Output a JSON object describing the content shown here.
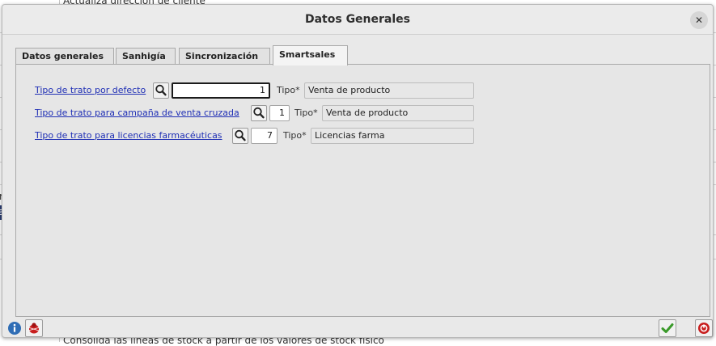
{
  "background": {
    "top_text": "Actualiza dirección de cliente",
    "left_fragments": [
      "r",
      "a"
    ],
    "bottom_text": "Consolida las líneas de stock a partir de los valores de stock físico"
  },
  "dialog": {
    "title": "Datos Generales",
    "close_glyph": "✕"
  },
  "tabs": [
    {
      "label": "Datos generales",
      "active": false
    },
    {
      "label": "Sanhigía",
      "active": false
    },
    {
      "label": "Sincronización",
      "active": false
    },
    {
      "label": "Smartsales",
      "active": true
    }
  ],
  "fields": [
    {
      "link": "Tipo de trato por defecto",
      "value": "1",
      "tipo_label": "Tipo*",
      "tipo_value": "Venta de producto",
      "focused": true
    },
    {
      "link": "Tipo de trato para campaña de venta cruzada",
      "value": "1",
      "tipo_label": "Tipo*",
      "tipo_value": "Venta de producto",
      "focused": false
    },
    {
      "link": "Tipo de trato para licencias farmacéuticas",
      "value": "7",
      "tipo_label": "Tipo*",
      "tipo_value": "Licencias farma",
      "focused": false
    }
  ],
  "footer": {
    "icons": [
      "info-icon",
      "debug-bug-icon",
      "accept-check-icon",
      "cancel-stop-icon"
    ]
  },
  "colors": {
    "link": "#1f2fb5",
    "check_green": "#3a9a2a",
    "cancel_red": "#c81e1e",
    "info_blue": "#2f6db5"
  }
}
